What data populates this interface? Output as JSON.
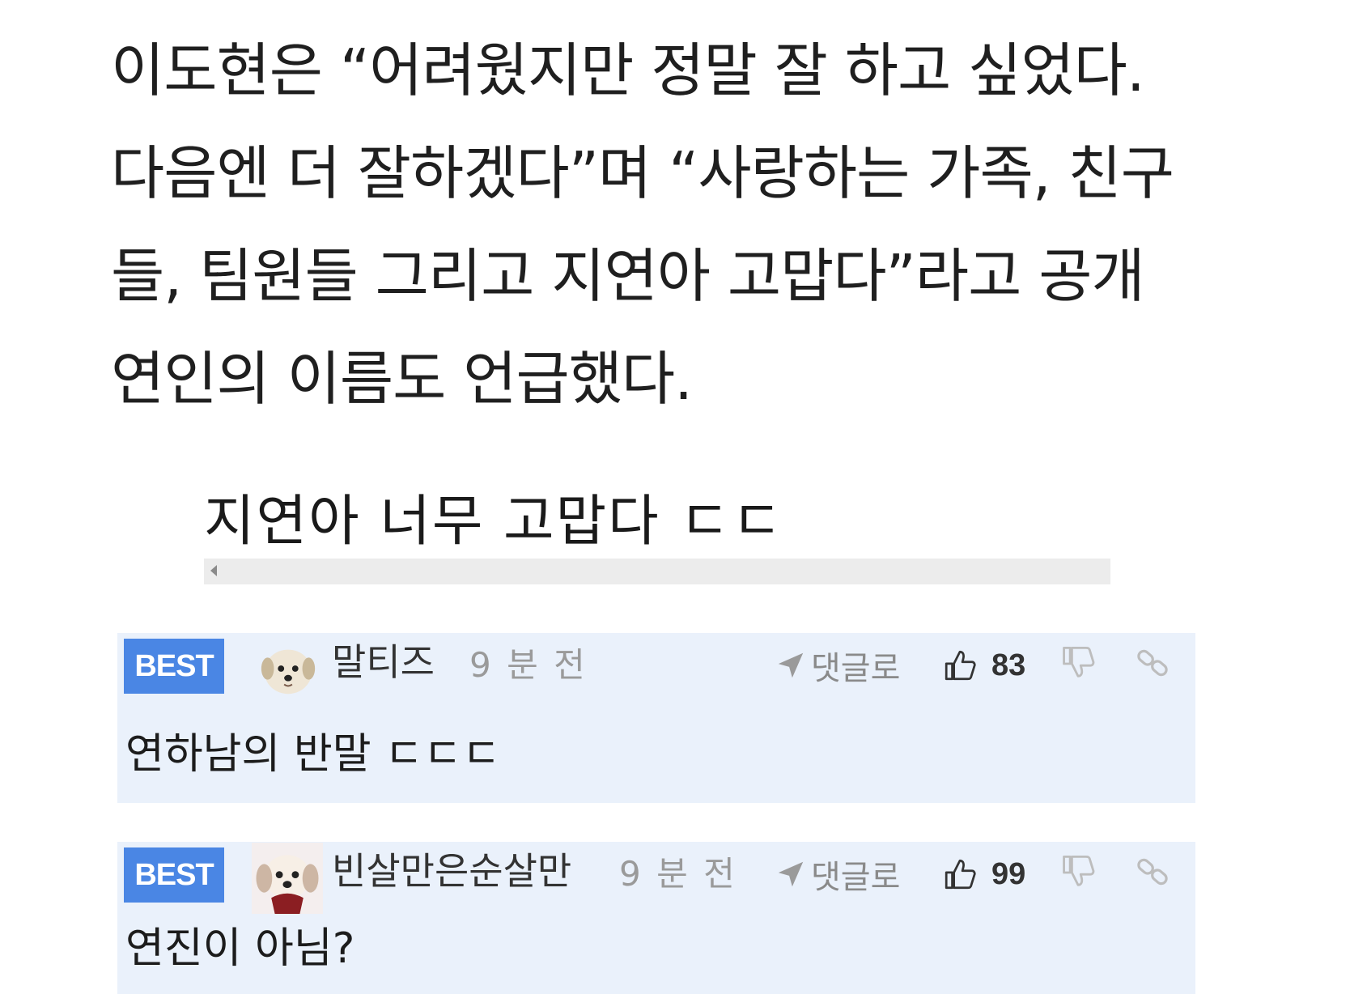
{
  "article": {
    "lines": [
      "이도현은 “어려웠지만 정말 잘 하고 싶었다.",
      "다음엔 더 잘하겠다”며 “사랑하는 가족, 친구",
      "들, 팀원들 그리고 지연아 고맙다”라고 공개",
      "연인의 이름도 언급했다."
    ]
  },
  "quote": {
    "text": "지연아 너무 고맙다 ㄷㄷ"
  },
  "comments": [
    {
      "badge": "BEST",
      "avatar_icon": "dog-avatar-icon",
      "nickname": "말티즈",
      "time": "9 분 전",
      "reply_label": "댓글로",
      "like_count": "83",
      "body": "연하남의 반말 ㄷㄷㄷ"
    },
    {
      "badge": "BEST",
      "avatar_icon": "dog-avatar-icon",
      "nickname": "빈살만은순살만",
      "time": "9 분 전",
      "reply_label": "댓글로",
      "like_count": "99",
      "body": "연진이 아님?"
    }
  ],
  "colors": {
    "best_badge_bg": "#4a86e4",
    "comment_bg": "#eaf1fb",
    "scrollbar_bg": "#ececec"
  }
}
